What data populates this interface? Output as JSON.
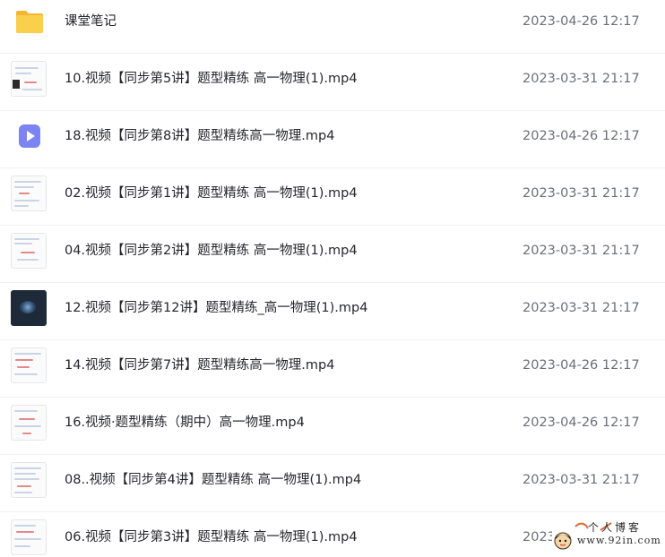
{
  "files": [
    {
      "name": "课堂笔记",
      "date": "2023-04-26 12:17",
      "icon": "folder-icon"
    },
    {
      "name": "10.视频【同步第5讲】题型精练 高一物理(1).mp4",
      "date": "2023-03-31 21:17",
      "icon": "video-thumbnail"
    },
    {
      "name": "18.视频【同步第8讲】题型精练高一物理.mp4",
      "date": "2023-04-26 12:17",
      "icon": "play-icon"
    },
    {
      "name": "02.视频【同步第1讲】题型精练 高一物理(1).mp4",
      "date": "2023-03-31 21:17",
      "icon": "video-thumbnail"
    },
    {
      "name": "04.视频【同步第2讲】题型精练 高一物理(1).mp4",
      "date": "2023-03-31 21:17",
      "icon": "video-thumbnail"
    },
    {
      "name": "12.视频【同步第12讲】题型精练_高一物理(1).mp4",
      "date": "2023-03-31 21:17",
      "icon": "video-thumbnail"
    },
    {
      "name": "14.视频【同步第7讲】题型精练高一物理.mp4",
      "date": "2023-04-26 12:17",
      "icon": "video-thumbnail"
    },
    {
      "name": "16.视频·题型精练（期中）高一物理.mp4",
      "date": "2023-04-26 12:17",
      "icon": "video-thumbnail"
    },
    {
      "name": "08..视频【同步第4讲】题型精练 高一物理(1).mp4",
      "date": "2023-03-31 21:17",
      "icon": "video-thumbnail"
    },
    {
      "name": "06.视频【同步第3讲】题型精练 高一物理(1).mp4",
      "date": "2023",
      "icon": "video-thumbnail"
    }
  ],
  "watermark": {
    "title": "个人博客",
    "url": "www.92in.com"
  },
  "colors": {
    "folder": "#f7c744",
    "play": "#7c83f2",
    "text": "#25262b",
    "date": "#6b6f78"
  }
}
